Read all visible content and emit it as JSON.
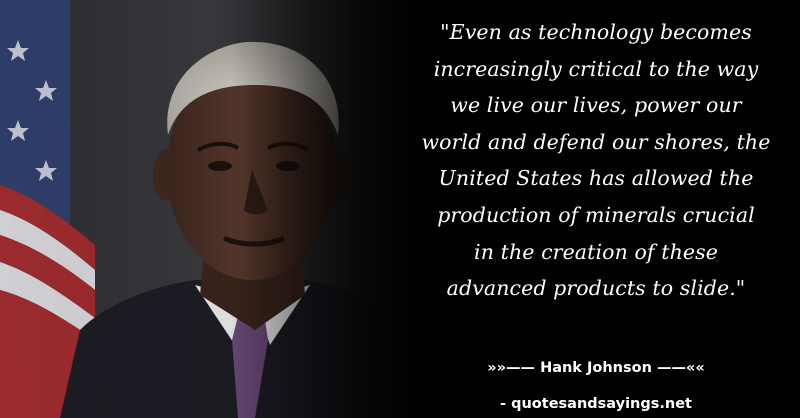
{
  "quote": {
    "text": "\"Even as technology becomes increasingly critical to the way we live our lives, power our world and defend our shores, the United States has allowed the production of minerals crucial in the creation of these advanced products to slide.\"",
    "lines": [
      "\"Even as technology becomes",
      "increasingly critical to the way",
      "we live our lives, power our",
      "world and defend our shores, the",
      "United States has allowed the",
      "production of minerals crucial",
      "in the creation of these",
      "advanced products to slide.\""
    ]
  },
  "attribution": {
    "text": "»»—— Hank Johnson ——««"
  },
  "source": {
    "text": "- quotesandsayings.net"
  },
  "colors": {
    "background": "#000000",
    "text": "#ffffff",
    "flag_red": "#9a2a2e",
    "flag_blue": "#2e3d68",
    "suit": "#1c1d24",
    "tie": "#6a4a78",
    "skin": "#4a3026",
    "hair": "#c9c5bd"
  },
  "image": {
    "subject": "portrait-photo"
  }
}
